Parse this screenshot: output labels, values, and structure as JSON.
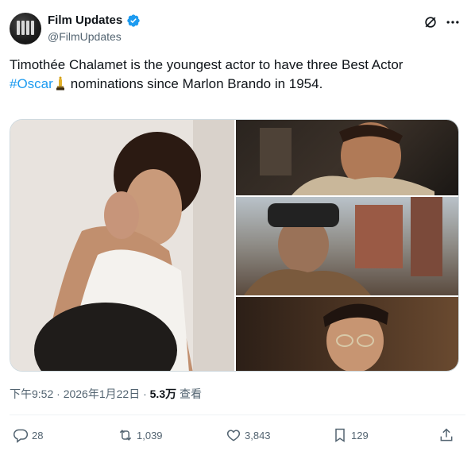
{
  "author": {
    "display_name": "Film Updates",
    "handle": "@FilmUpdates",
    "verified_icon": "verified-badge-icon",
    "avatar_icon": "film-updates-logo"
  },
  "tweet": {
    "text_part1": "Timothée Chalamet is the youngest actor to have three Best Actor",
    "hashtag": "#Oscar",
    "emoji_icon": "trophy-icon",
    "text_part2": "nominations since Marlon Brando in 1954."
  },
  "media": {
    "images": [
      {
        "name": "photo-white-tank-top"
      },
      {
        "name": "photo-still-1"
      },
      {
        "name": "photo-still-2"
      },
      {
        "name": "photo-still-3"
      }
    ]
  },
  "meta": {
    "timestamp": "下午9:52 · 2026年1月22日 ·",
    "views_count": "5.3万",
    "views_label": "查看"
  },
  "actions": {
    "replies": "28",
    "reposts": "1,039",
    "likes": "3,843",
    "bookmarks": "129"
  },
  "colors": {
    "accent": "#1d9bf0",
    "text": "#0f1419",
    "secondary": "#536471"
  }
}
